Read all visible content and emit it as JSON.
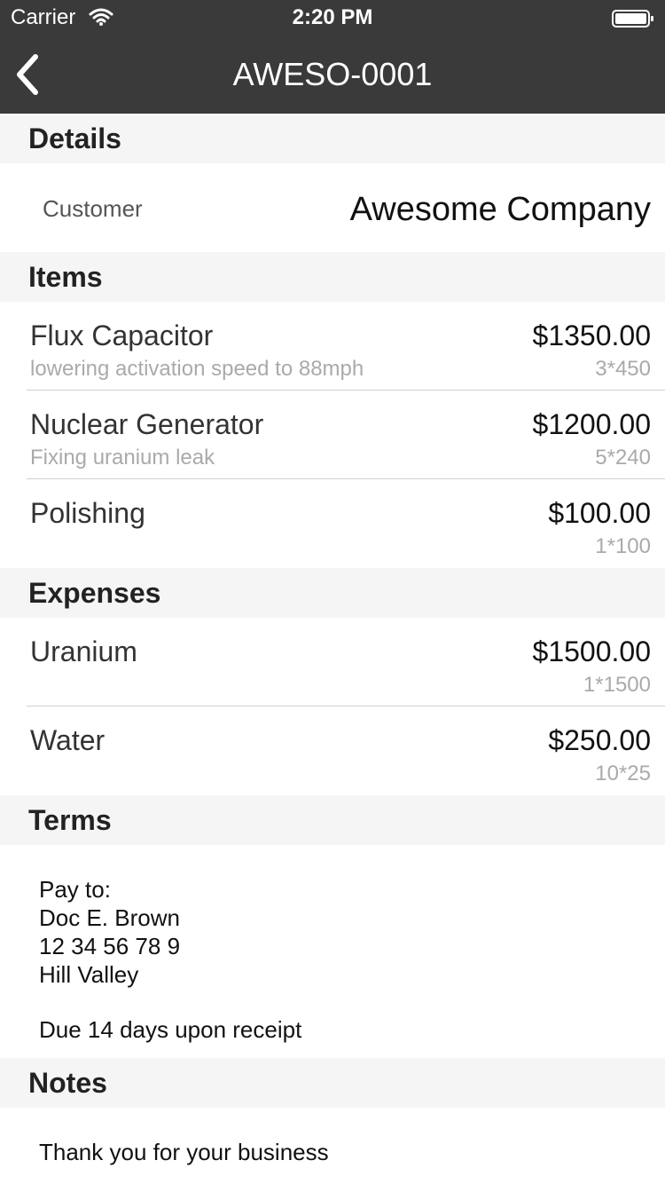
{
  "status_bar": {
    "carrier": "Carrier",
    "time": "2:20 PM"
  },
  "nav": {
    "title": "AWESO-0001"
  },
  "details": {
    "header": "Details",
    "customer_label": "Customer",
    "customer_value": "Awesome Company"
  },
  "items": {
    "header": "Items",
    "rows": [
      {
        "title": "Flux Capacitor",
        "subtitle": "lowering activation speed to 88mph",
        "amount": "$1350.00",
        "qty": "3*450"
      },
      {
        "title": "Nuclear Generator",
        "subtitle": "Fixing uranium leak",
        "amount": "$1200.00",
        "qty": "5*240"
      },
      {
        "title": "Polishing",
        "subtitle": "",
        "amount": "$100.00",
        "qty": "1*100"
      }
    ]
  },
  "expenses": {
    "header": "Expenses",
    "rows": [
      {
        "title": "Uranium",
        "amount": "$1500.00",
        "qty": "1*1500"
      },
      {
        "title": "Water",
        "amount": "$250.00",
        "qty": "10*25"
      }
    ]
  },
  "terms": {
    "header": "Terms",
    "lines": [
      "Pay to:",
      "Doc E. Brown",
      "12 34 56 78 9",
      "Hill Valley",
      "Due 14 days upon receipt"
    ]
  },
  "notes": {
    "header": "Notes",
    "text": "Thank you for your business"
  }
}
